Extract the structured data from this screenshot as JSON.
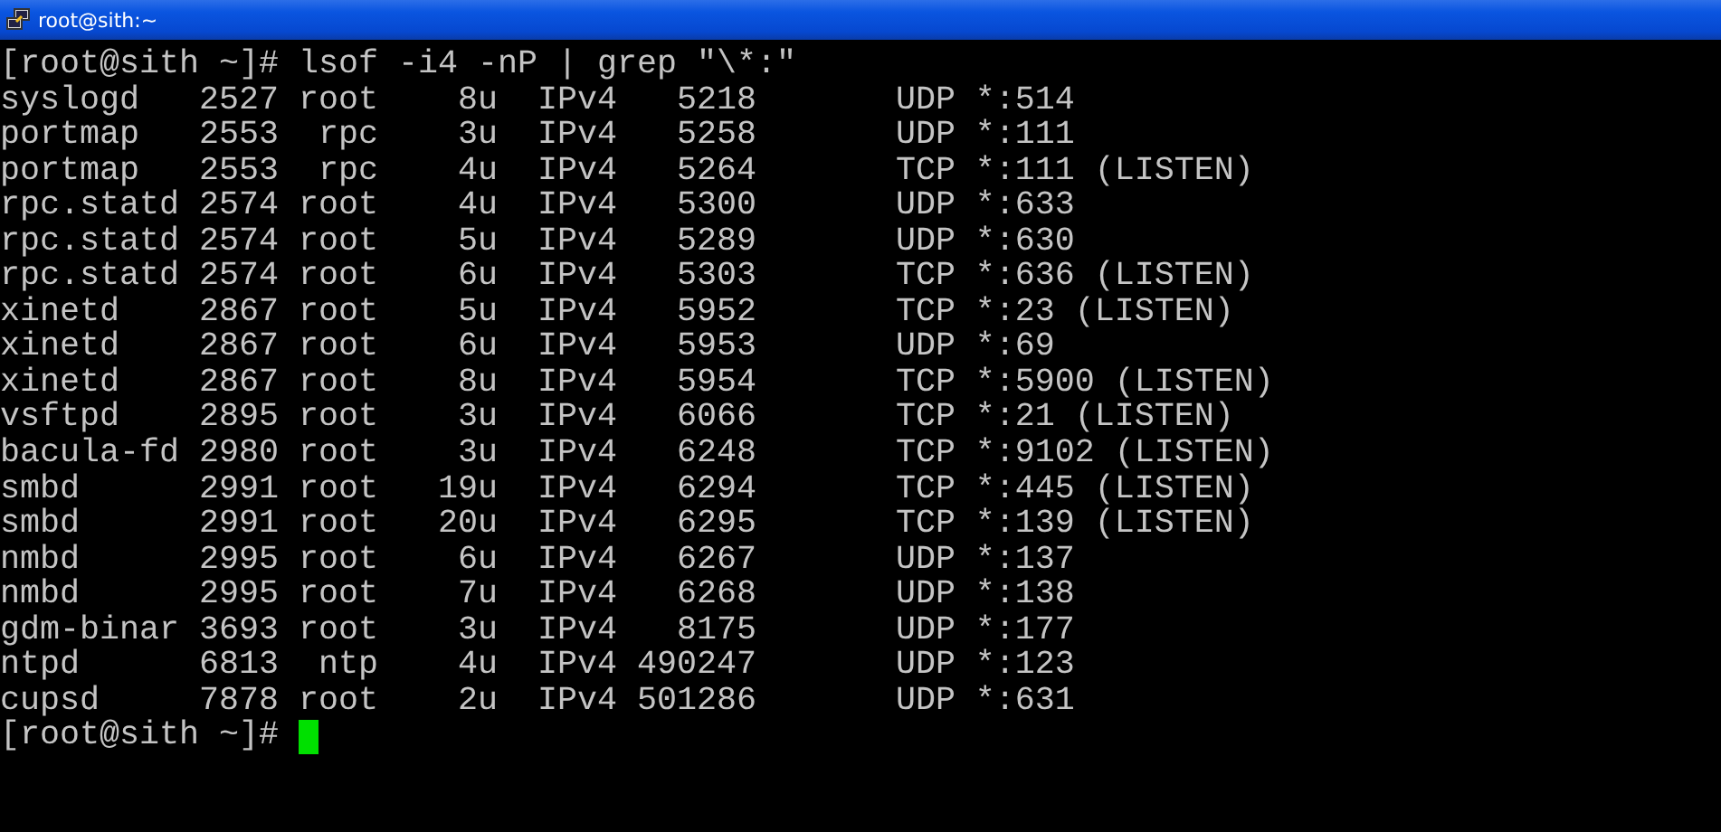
{
  "window": {
    "title": "root@sith:~"
  },
  "terminal": {
    "lines": [
      "[root@sith ~]# lsof -i4 -nP | grep \"\\*:\"",
      "syslogd   2527 root    8u  IPv4   5218       UDP *:514",
      "portmap   2553  rpc    3u  IPv4   5258       UDP *:111",
      "portmap   2553  rpc    4u  IPv4   5264       TCP *:111 (LISTEN)",
      "rpc.statd 2574 root    4u  IPv4   5300       UDP *:633",
      "rpc.statd 2574 root    5u  IPv4   5289       UDP *:630",
      "rpc.statd 2574 root    6u  IPv4   5303       TCP *:636 (LISTEN)",
      "xinetd    2867 root    5u  IPv4   5952       TCP *:23 (LISTEN)",
      "xinetd    2867 root    6u  IPv4   5953       UDP *:69",
      "xinetd    2867 root    8u  IPv4   5954       TCP *:5900 (LISTEN)",
      "vsftpd    2895 root    3u  IPv4   6066       TCP *:21 (LISTEN)",
      "bacula-fd 2980 root    3u  IPv4   6248       TCP *:9102 (LISTEN)",
      "smbd      2991 root   19u  IPv4   6294       TCP *:445 (LISTEN)",
      "smbd      2991 root   20u  IPv4   6295       TCP *:139 (LISTEN)",
      "nmbd      2995 root    6u  IPv4   6267       UDP *:137",
      "nmbd      2995 root    7u  IPv4   6268       UDP *:138",
      "gdm-binar 3693 root    3u  IPv4   8175       UDP *:177",
      "ntpd      6813  ntp    4u  IPv4 490247       UDP *:123",
      "cupsd     7878 root    2u  IPv4 501286       UDP *:631"
    ],
    "prompt": "[root@sith ~]# "
  }
}
